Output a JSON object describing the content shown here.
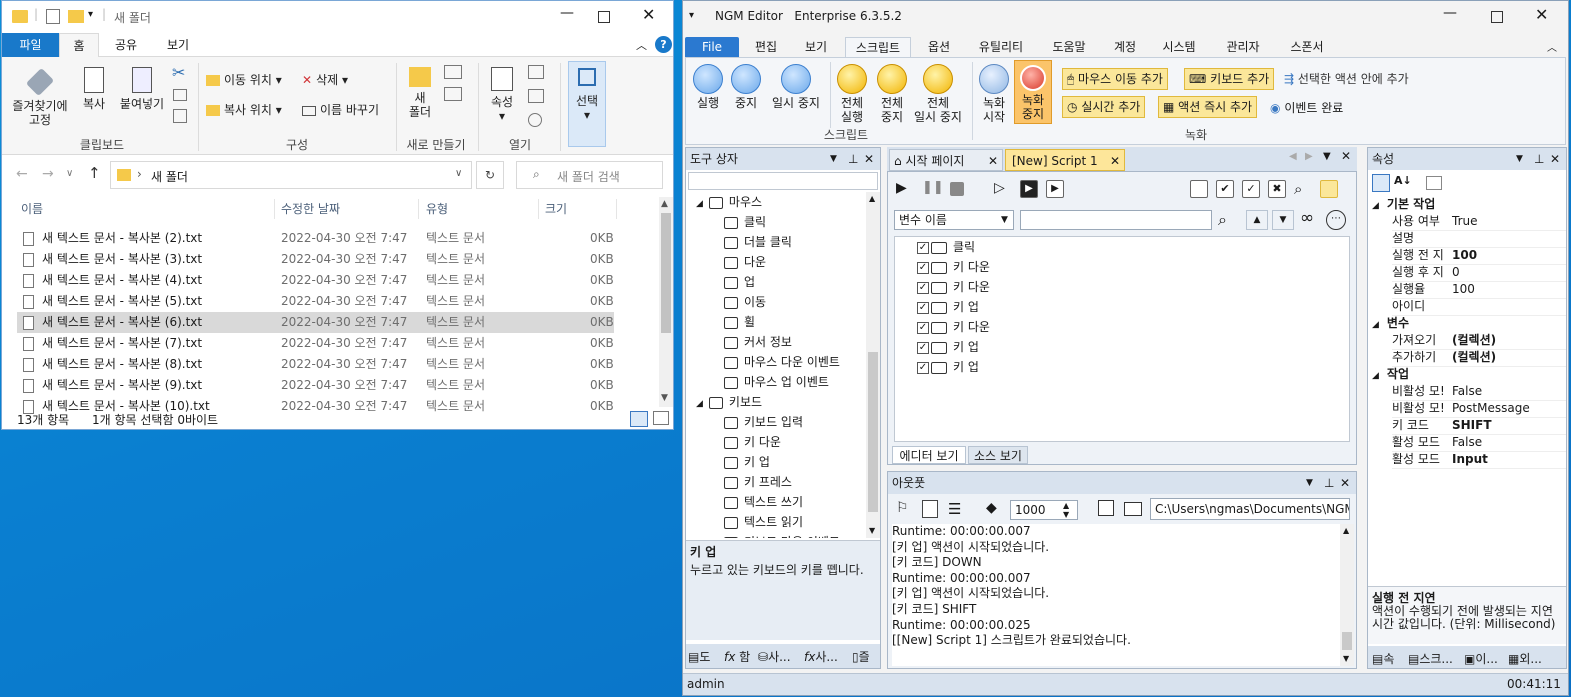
{
  "explorer": {
    "title": "새 폴더",
    "tabs": [
      "파일",
      "홈",
      "공유",
      "보기"
    ],
    "ribbon": {
      "pin": "즐겨찾기에\n고정",
      "copy": "복사",
      "paste": "붙여넣기",
      "clipboard_group": "클립보드",
      "move_to": "이동 위치",
      "copy_to": "복사 위치",
      "delete": "삭제",
      "rename": "이름 바꾸기",
      "organize_group": "구성",
      "new_folder": "새\n폴더",
      "new_group": "새로 만들기",
      "properties": "속성",
      "open_group": "열기",
      "select": "선택"
    },
    "address": "새 폴더",
    "search_placeholder": "새 폴더 검색",
    "columns": [
      "이름",
      "수정한 날짜",
      "유형",
      "크기"
    ],
    "rows": [
      {
        "name": "새 텍스트 문서 - 복사본 (2).txt",
        "date": "2022-04-30 오전 7:47",
        "type": "텍스트 문서",
        "size": "0KB"
      },
      {
        "name": "새 텍스트 문서 - 복사본 (3).txt",
        "date": "2022-04-30 오전 7:47",
        "type": "텍스트 문서",
        "size": "0KB"
      },
      {
        "name": "새 텍스트 문서 - 복사본 (4).txt",
        "date": "2022-04-30 오전 7:47",
        "type": "텍스트 문서",
        "size": "0KB"
      },
      {
        "name": "새 텍스트 문서 - 복사본 (5).txt",
        "date": "2022-04-30 오전 7:47",
        "type": "텍스트 문서",
        "size": "0KB"
      },
      {
        "name": "새 텍스트 문서 - 복사본 (6).txt",
        "date": "2022-04-30 오전 7:47",
        "type": "텍스트 문서",
        "size": "0KB"
      },
      {
        "name": "새 텍스트 문서 - 복사본 (7).txt",
        "date": "2022-04-30 오전 7:47",
        "type": "텍스트 문서",
        "size": "0KB"
      },
      {
        "name": "새 텍스트 문서 - 복사본 (8).txt",
        "date": "2022-04-30 오전 7:47",
        "type": "텍스트 문서",
        "size": "0KB"
      },
      {
        "name": "새 텍스트 문서 - 복사본 (9).txt",
        "date": "2022-04-30 오전 7:47",
        "type": "텍스트 문서",
        "size": "0KB"
      },
      {
        "name": "새 텍스트 문서 - 복사본 (10).txt",
        "date": "2022-04-30 오전 7:47",
        "type": "텍스트 문서",
        "size": "0KB"
      }
    ],
    "status_count": "13개 항목",
    "status_selected": "1개 항목 선택함 0바이트"
  },
  "ngm": {
    "title": "NGM Editor   Enterprise 6.3.5.2",
    "menu": [
      "File",
      "편집",
      "보기",
      "스크립트",
      "옵션",
      "유틸리티",
      "도움말",
      "계정",
      "시스템",
      "관리자",
      "스폰서"
    ],
    "ribbon": {
      "run": "실행",
      "stop": "중지",
      "pause": "일시 중지",
      "run_all": "전체\n실행",
      "stop_all": "전체\n중지",
      "pause_all": "전체\n일시 중지",
      "script_group": "스크립트",
      "rec_start": "녹화\n시작",
      "rec_stop": "녹화\n중지",
      "add_mouse_move": "마우스 이동 추가",
      "add_keyboard": "키보드 추가",
      "add_in_selected": "선택한 액션 안에 추가",
      "add_realtime": "실시간 추가",
      "add_action_now": "액션 즉시 추가",
      "event_done": "이벤트 완료",
      "record_group": "녹화"
    },
    "toolbox": {
      "title": "도구 상자",
      "items": [
        "마우스",
        "클릭",
        "더블 클릭",
        "다운",
        "업",
        "이동",
        "휠",
        "커서 정보",
        "마우스 다운 이벤트",
        "마우스 업 이벤트",
        "키보드",
        "키보드 입력",
        "키 다운",
        "키 업",
        "키 프레스",
        "텍스트 쓰기",
        "텍스트 읽기",
        "키보드 다운 이벤트"
      ],
      "desc_title": "키 업",
      "desc": "누르고 있는 키보드의 키를 뗍니다.",
      "bottom_tabs": [
        "도",
        "함",
        "사...",
        "사...",
        "즐"
      ]
    },
    "doc_tabs": [
      "시작 페이지",
      "[New] Script 1"
    ],
    "var_select": "변수 이름",
    "script_lines": [
      "클릭",
      "키 다운",
      "키 다운",
      "키 업",
      "키 다운",
      "키 업",
      "키 업"
    ],
    "view_tabs": [
      "에디터 보기",
      "소스 보기"
    ],
    "output": {
      "title": "아웃풋",
      "count": "1000",
      "path": "C:\\Users\\ngmas\\Documents\\NGM6\\",
      "lines": [
        "Runtime: 00:00:00.007",
        "[키 업] 액션이 시작되었습니다.",
        "[키 코드] DOWN",
        "Runtime: 00:00:00.007",
        "[키 업] 액션이 시작되었습니다.",
        "[키 코드] SHIFT",
        "Runtime: 00:00:00.025",
        "[[New] Script 1] 스크립트가 완료되었습니다."
      ]
    },
    "props": {
      "title": "속성",
      "sec_basic": "기본 작업",
      "basic": [
        {
          "k": "사용 여부",
          "v": "True",
          "b": false
        },
        {
          "k": "설명",
          "v": "",
          "b": false
        },
        {
          "k": "실행 전 지",
          "v": "100",
          "b": true
        },
        {
          "k": "실행 후 지",
          "v": "0",
          "b": false
        },
        {
          "k": "실행율",
          "v": "100",
          "b": false
        },
        {
          "k": "아이디",
          "v": "",
          "b": false
        }
      ],
      "sec_var": "변수",
      "vars": [
        {
          "k": "가져오기",
          "v": "(컬렉션)",
          "b": true
        },
        {
          "k": "추가하기",
          "v": "(컬렉션)",
          "b": true
        }
      ],
      "sec_task": "작업",
      "task": [
        {
          "k": "비활성 모!",
          "v": "False",
          "b": false
        },
        {
          "k": "비활성 모!",
          "v": "PostMessage",
          "b": false
        },
        {
          "k": "키 코드",
          "v": "SHIFT",
          "b": true
        },
        {
          "k": "활성 모드",
          "v": "False",
          "b": false
        },
        {
          "k": "활성 모드",
          "v": "Input",
          "b": true
        }
      ],
      "desc_title": "실행 전 지연",
      "desc": "액션이 수행되기 전에 발생되는 지연 시간 값입니다. (단위: Millisecond)",
      "bottom_tabs": [
        "속",
        "스크...",
        "이...",
        "외..."
      ]
    },
    "status_user": "admin",
    "status_time": "00:41:11"
  },
  "colors": {
    "accent": "#1979ca",
    "ribbon_hl": "#fbe79a",
    "desktop": "#0a7fd0"
  }
}
